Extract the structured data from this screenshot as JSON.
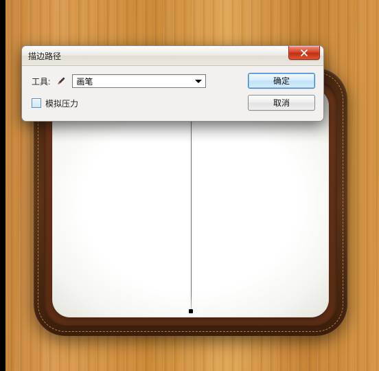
{
  "dialog": {
    "title": "描边路径",
    "tool_label": "工具:",
    "tool_value": "画笔",
    "simulate_pressure_label": "模拟压力",
    "simulate_pressure_checked": false,
    "ok_label": "确定",
    "cancel_label": "取消"
  },
  "icons": {
    "close": "close-icon",
    "brush": "brush-icon",
    "dropdown": "chevron-down-icon"
  }
}
